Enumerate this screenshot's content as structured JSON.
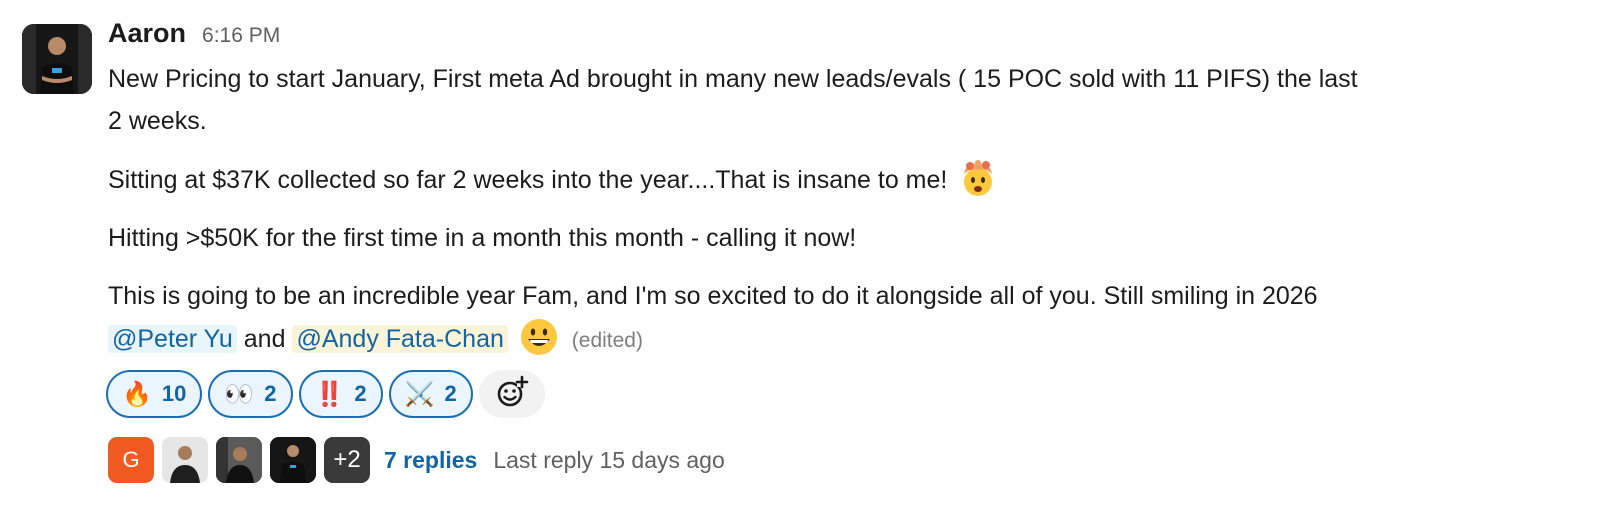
{
  "message": {
    "author": "Aaron",
    "time": "6:16 PM",
    "line1": "New Pricing to start January, First meta Ad brought in many new leads/evals ( 15 POC sold with 11 PIFS) the last",
    "line2": "2 weeks.",
    "para2": "Sitting at $37K collected so far 2 weeks into the year....That is insane to me!",
    "para3": "Hitting >$50K for the first time in a month this month - calling it now!",
    "para4_line1": "This is going to be an incredible year Fam, and I'm so excited to do it alongside all of you. Still smiling in 2026",
    "mention1": "@Peter Yu",
    "and_text": "and",
    "mention2": "@Andy Fata-Chan",
    "edited": "(edited)"
  },
  "reactions": [
    {
      "icon": "fire-emoji",
      "glyph": "🔥",
      "count": "10"
    },
    {
      "icon": "eyes-emoji",
      "glyph": "👀",
      "count": "2"
    },
    {
      "icon": "double-exclamation-emoji",
      "glyph": "‼️",
      "count": "2"
    },
    {
      "icon": "crossed-swords-emoji",
      "glyph": "⚔️",
      "count": "2"
    }
  ],
  "thread": {
    "first_avatar_letter": "G",
    "more_count": "+2",
    "replies": "7 replies",
    "last_reply": "Last reply 15 days ago"
  }
}
